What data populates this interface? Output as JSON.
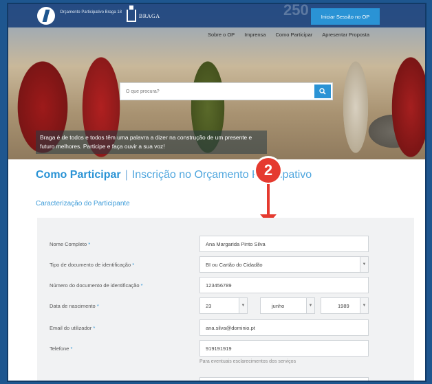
{
  "header": {
    "org_name": "Orçamento Participativo Braga 18",
    "city_logo": "BRAGA",
    "deco_number": "250",
    "login_label": "Iniciar Sessão no OP",
    "nav": [
      "Sobre o OP",
      "Imprensa",
      "Como Participar",
      "Apresentar Proposta"
    ],
    "search_placeholder": "O que procura?",
    "tagline": "Braga é de todos e todos têm uma palavra a dizer na construção de um presente e futuro melhores. Participe e faça ouvir a sua voz!"
  },
  "page": {
    "title_main": "Como Participar",
    "title_separator": "|",
    "title_sub": "Inscrição no Orçamento Participativo",
    "step_number": "2",
    "section_title": "Caracterização do Participante"
  },
  "form": {
    "required_mark": "*",
    "fields": {
      "full_name": {
        "label": "Nome Completo",
        "value": "Ana Margarida Pinto Silva"
      },
      "doc_type": {
        "label": "Tipo de documento de identificação",
        "value": "BI ou Cartão do Cidadão"
      },
      "doc_number": {
        "label": "Número do documento de identificação",
        "value": "123456789"
      },
      "birth_date": {
        "label": "Data de nascimento",
        "day": "23",
        "month": "junho",
        "year": "1989"
      },
      "email": {
        "label": "Email do utilizador",
        "value": "ana.silva@dominio.pt"
      },
      "phone": {
        "label": "Telefone",
        "value": "919191919",
        "hint": "Para eventuais esclarecimentos dos serviços"
      }
    }
  },
  "colors": {
    "accent": "#2a93d5",
    "badge": "#e53a2f",
    "frame": "#1e568f"
  }
}
